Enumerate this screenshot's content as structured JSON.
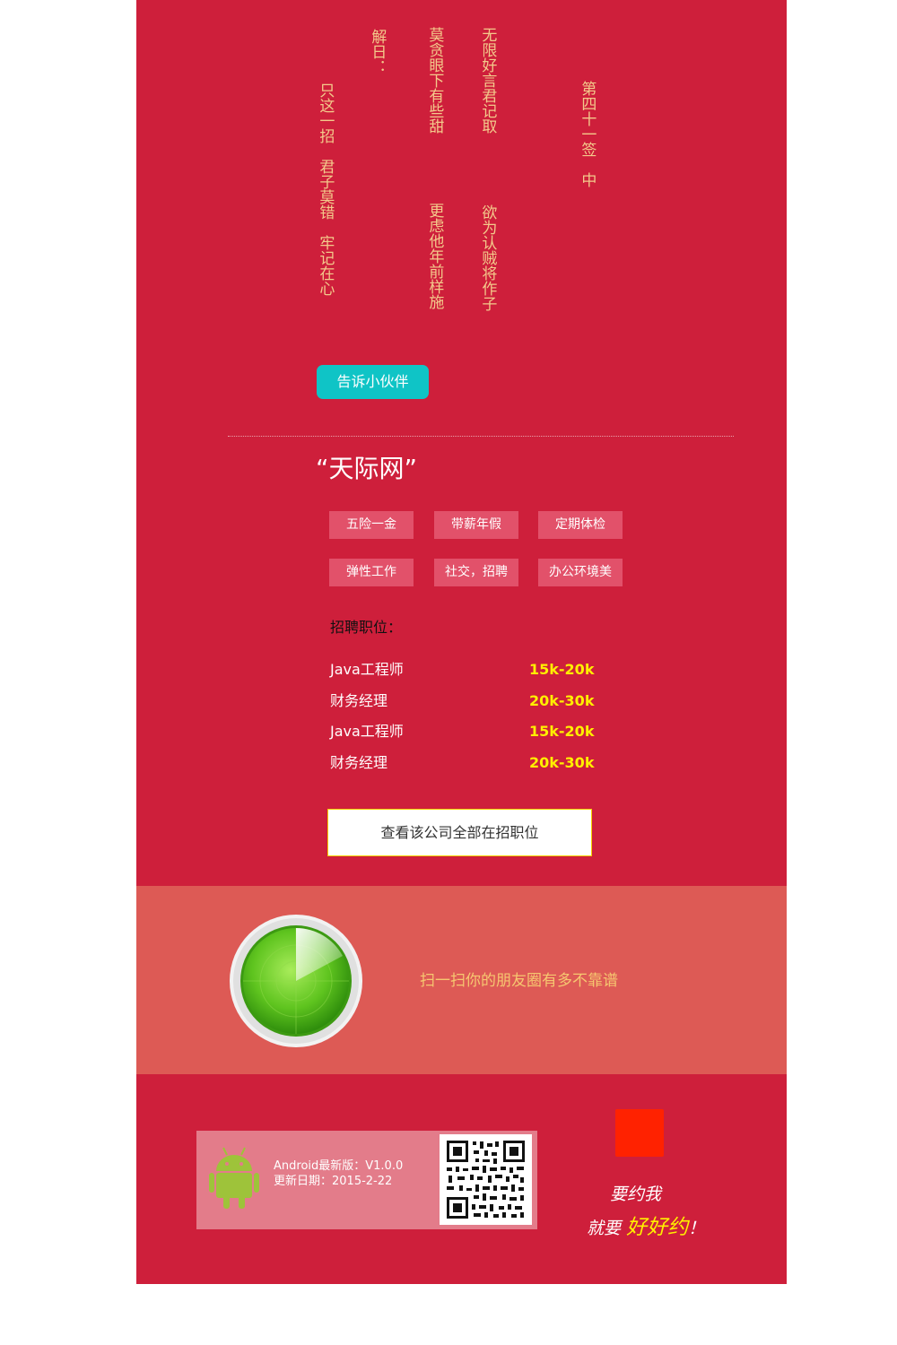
{
  "fortune": {
    "title_col": "第四十一签　中",
    "col1_top": "无限好言君记取",
    "col1_bottom": "欲为认贼将作子",
    "col2_top": "莫贪眼下有些甜",
    "col2_bottom": "更虑他年前样施",
    "explain_label": "解日：",
    "explain_col": "只这一招　君子莫错　牢记在心"
  },
  "share_button": "告诉小伙伴",
  "company": {
    "name": "“天际网”",
    "tags": [
      "五险一金",
      "带薪年假",
      "定期体检",
      "弹性工作",
      "社交，招聘",
      "办公环境美"
    ]
  },
  "jobs": {
    "label": "招聘职位：",
    "items": [
      {
        "title": "Java工程师",
        "salary": "15k-20k"
      },
      {
        "title": "财务经理",
        "salary": "20k-30k"
      },
      {
        "title": "Java工程师",
        "salary": "15k-20k"
      },
      {
        "title": "财务经理",
        "salary": "20k-30k"
      }
    ],
    "all_button": "查看该公司全部在招职位"
  },
  "scan": {
    "text": "扫一扫你的朋友圈有多不靠谱",
    "icon": "radar-icon"
  },
  "app": {
    "icon": "android-icon",
    "version": "Android最新版：V1.0.0",
    "date": "更新日期：2015-2-22",
    "qr": "qr-code"
  },
  "slogan": {
    "line1": "要约我",
    "line2_prefix": "就要",
    "line2_highlight": "好好约",
    "line2_suffix": "！"
  },
  "colors": {
    "panel": "#ce1f3b",
    "accent_teal": "#0fc4c6",
    "band": "#dd5a55",
    "salary_yellow": "#ffef00"
  }
}
